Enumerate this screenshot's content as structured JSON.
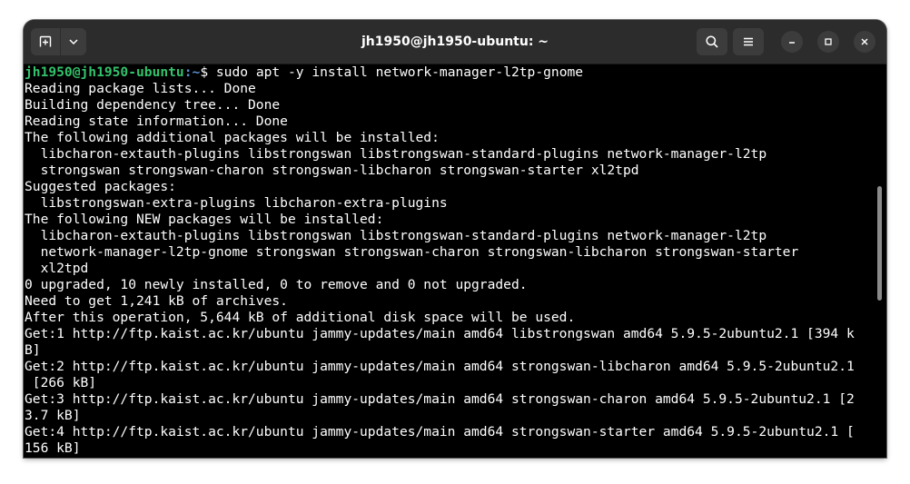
{
  "window": {
    "title": "jh1950@jh1950-ubuntu: ~"
  },
  "toolbar": {
    "new_tab_icon": "new-tab-icon",
    "dropdown_icon": "chevron-down-icon",
    "search_icon": "search-icon",
    "menu_icon": "hamburger-menu-icon"
  },
  "window_controls": {
    "minimize_icon": "minimize-icon",
    "maximize_icon": "maximize-icon",
    "close_icon": "close-icon"
  },
  "terminal": {
    "prompt": {
      "user_host": "jh1950@jh1950-ubuntu",
      "path": ":~",
      "symbol": "$",
      "command": " sudo apt -y install network-manager-l2tp-gnome"
    },
    "output": [
      "Reading package lists... Done",
      "Building dependency tree... Done",
      "Reading state information... Done",
      "The following additional packages will be installed:",
      "  libcharon-extauth-plugins libstrongswan libstrongswan-standard-plugins network-manager-l2tp",
      "  strongswan strongswan-charon strongswan-libcharon strongswan-starter xl2tpd",
      "Suggested packages:",
      "  libstrongswan-extra-plugins libcharon-extra-plugins",
      "The following NEW packages will be installed:",
      "  libcharon-extauth-plugins libstrongswan libstrongswan-standard-plugins network-manager-l2tp",
      "  network-manager-l2tp-gnome strongswan strongswan-charon strongswan-libcharon strongswan-starter",
      "  xl2tpd",
      "0 upgraded, 10 newly installed, 0 to remove and 0 not upgraded.",
      "Need to get 1,241 kB of archives.",
      "After this operation, 5,644 kB of additional disk space will be used.",
      "Get:1 http://ftp.kaist.ac.kr/ubuntu jammy-updates/main amd64 libstrongswan amd64 5.9.5-2ubuntu2.1 [394 k",
      "B]",
      "Get:2 http://ftp.kaist.ac.kr/ubuntu jammy-updates/main amd64 strongswan-libcharon amd64 5.9.5-2ubuntu2.1",
      " [266 kB]",
      "Get:3 http://ftp.kaist.ac.kr/ubuntu jammy-updates/main amd64 strongswan-charon amd64 5.9.5-2ubuntu2.1 [2",
      "3.7 kB]",
      "Get:4 http://ftp.kaist.ac.kr/ubuntu jammy-updates/main amd64 strongswan-starter amd64 5.9.5-2ubuntu2.1 [",
      "156 kB]"
    ]
  },
  "colors": {
    "titlebar_bg": "#2c2c2c",
    "terminal_bg": "#000000",
    "prompt_user": "#33c26b",
    "prompt_path": "#5b8fd6",
    "text": "#ffffff"
  }
}
